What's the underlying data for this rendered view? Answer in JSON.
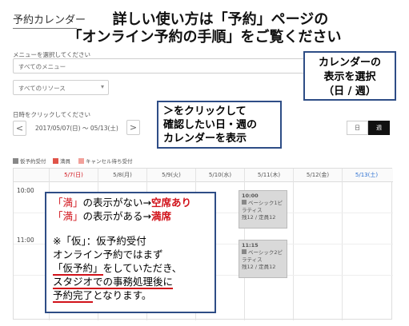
{
  "app": {
    "title": "予約カレンダー"
  },
  "headline": {
    "line1": "詳しい使い方は「予約」ページの",
    "line2": "「オンライン予約の手順」をご覧ください"
  },
  "filters": {
    "menu_label": "メニューを選択してください",
    "menu_value": "すべてのメニュー",
    "resource_value": "すべてのリソース"
  },
  "date_nav": {
    "label": "日時をクリックしてください",
    "range": "2017/05/07(日) ～ 05/13(土)",
    "prev": "<",
    "next": ">"
  },
  "view_toggle": {
    "day": "日",
    "week": "週"
  },
  "legend": [
    {
      "label": "仮予約受付",
      "color": "#888888"
    },
    {
      "label": "満員",
      "color": "#e0544a"
    },
    {
      "label": "キャンセル待ち受付",
      "color": "#f2a09a"
    }
  ],
  "calendar": {
    "days": [
      "5/7(日)",
      "5/8(月)",
      "5/9(火)",
      "5/10(水)",
      "5/11(木)",
      "5/12(金)",
      "5/13(土)"
    ],
    "day_colors": [
      "#d1121a",
      "#555555",
      "#555555",
      "#555555",
      "#555555",
      "#555555",
      "#2a6fd1"
    ],
    "times": [
      "10:00",
      "11:00"
    ],
    "slots": [
      {
        "time": "10:00",
        "name_line1": "ベーシック1ピ",
        "name_line2": "ラティス",
        "seats": "残12 / 定員12"
      },
      {
        "time": "11:15",
        "name_line1": "ベーシック2ピ",
        "name_line2": "ラティス",
        "seats": "残12 / 定員12"
      }
    ]
  },
  "callouts": {
    "view": {
      "l1": "カレンダーの",
      "l2": "表示を選択",
      "l3": "（日 / 週）"
    },
    "nav": {
      "l1": "＞をクリックして",
      "l2": "確認したい日・週の",
      "l3": "カレンダーを表示"
    },
    "info": {
      "a1": "「満」",
      "a2": "の表示がない→",
      "a3": "空席あり",
      "b1": "「満」",
      "b2": "の表示がある→",
      "b3": "満席",
      "c1": "※「仮」：仮予約受付",
      "c2": "オンライン予約ではまず",
      "c3a": "「仮予約」",
      "c3b": "をしていただき、",
      "c4": "スタジオでの事務処理後に",
      "c5a": "予約完了",
      "c5b": "となります。"
    }
  }
}
